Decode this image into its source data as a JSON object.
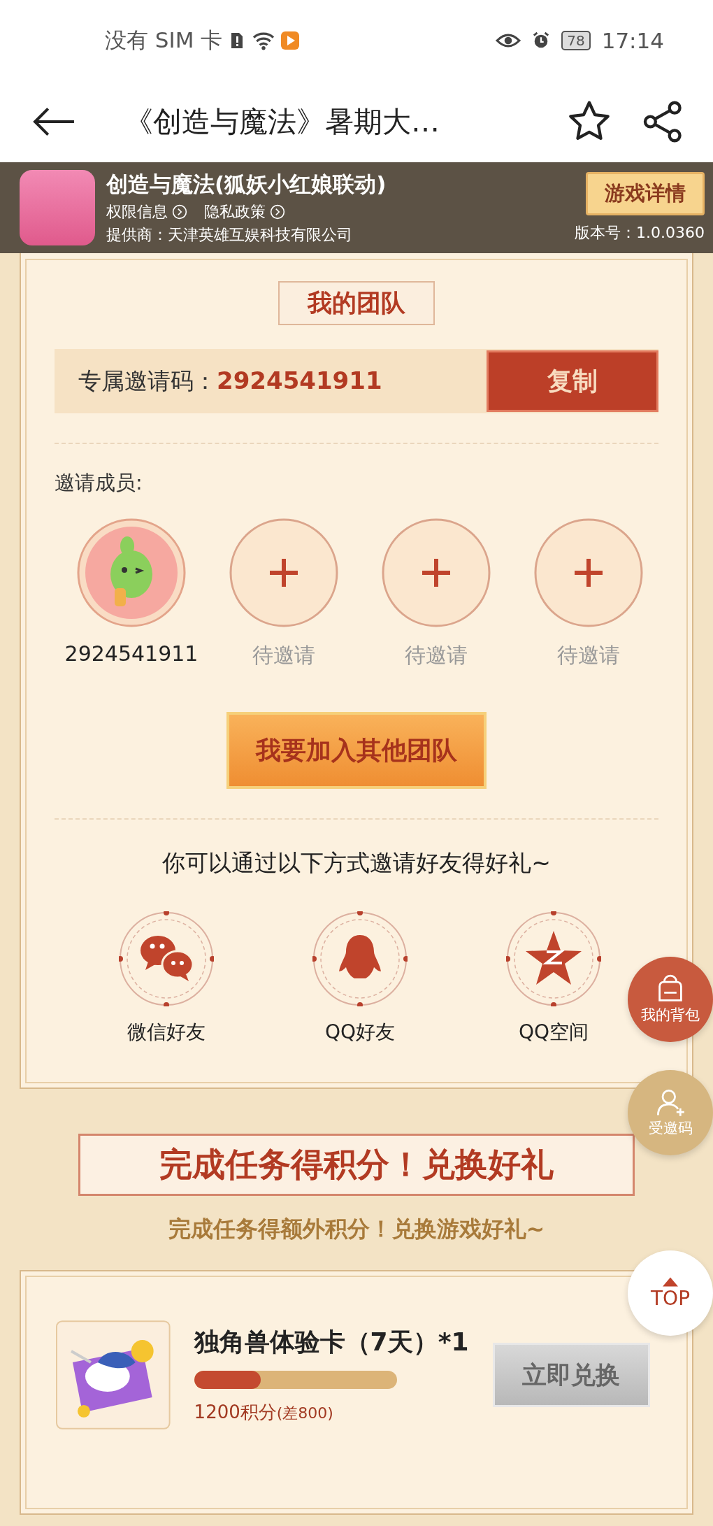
{
  "status_bar": {
    "carrier": "没有 SIM 卡",
    "battery": "78",
    "time": "17:14"
  },
  "header": {
    "title": "《创造与魔法》暑期大…"
  },
  "app_banner": {
    "name": "创造与魔法(狐妖小红娘联动)",
    "links": [
      "权限信息",
      "隐私政策"
    ],
    "provider": "提供商：天津英雄互娱科技有限公司",
    "detail_button": "游戏详情",
    "version": "版本号：1.0.0360"
  },
  "team": {
    "title": "我的团队",
    "invite_code_label": "专属邀请码：",
    "invite_code": "2924541911",
    "copy_button": "复制",
    "members_label": "邀请成员:",
    "members": [
      {
        "kind": "member",
        "label": "2924541911"
      },
      {
        "kind": "empty",
        "label": "待邀请"
      },
      {
        "kind": "empty",
        "label": "待邀请"
      },
      {
        "kind": "empty",
        "label": "待邀请"
      }
    ],
    "join_button": "我要加入其他团队",
    "share_hint": "你可以通过以下方式邀请好友得好礼~",
    "share": [
      {
        "kind": "wechat",
        "label": "微信好友"
      },
      {
        "kind": "qq",
        "label": "QQ好友"
      },
      {
        "kind": "qzone",
        "label": "QQ空间"
      }
    ]
  },
  "floating": {
    "backpack": "我的背包",
    "invited_code": "受邀码",
    "top": "TOP"
  },
  "tasks": {
    "title": "完成任务得积分！兑换好礼",
    "subtitle": "完成任务得额外积分！兑换游戏好礼~",
    "items": [
      {
        "name": "独角兽体验卡（7天）*1",
        "level": 0.33,
        "points": "1200积分",
        "shortfall": "(差800)",
        "button": "立即兑换",
        "disabled": true
      }
    ]
  }
}
